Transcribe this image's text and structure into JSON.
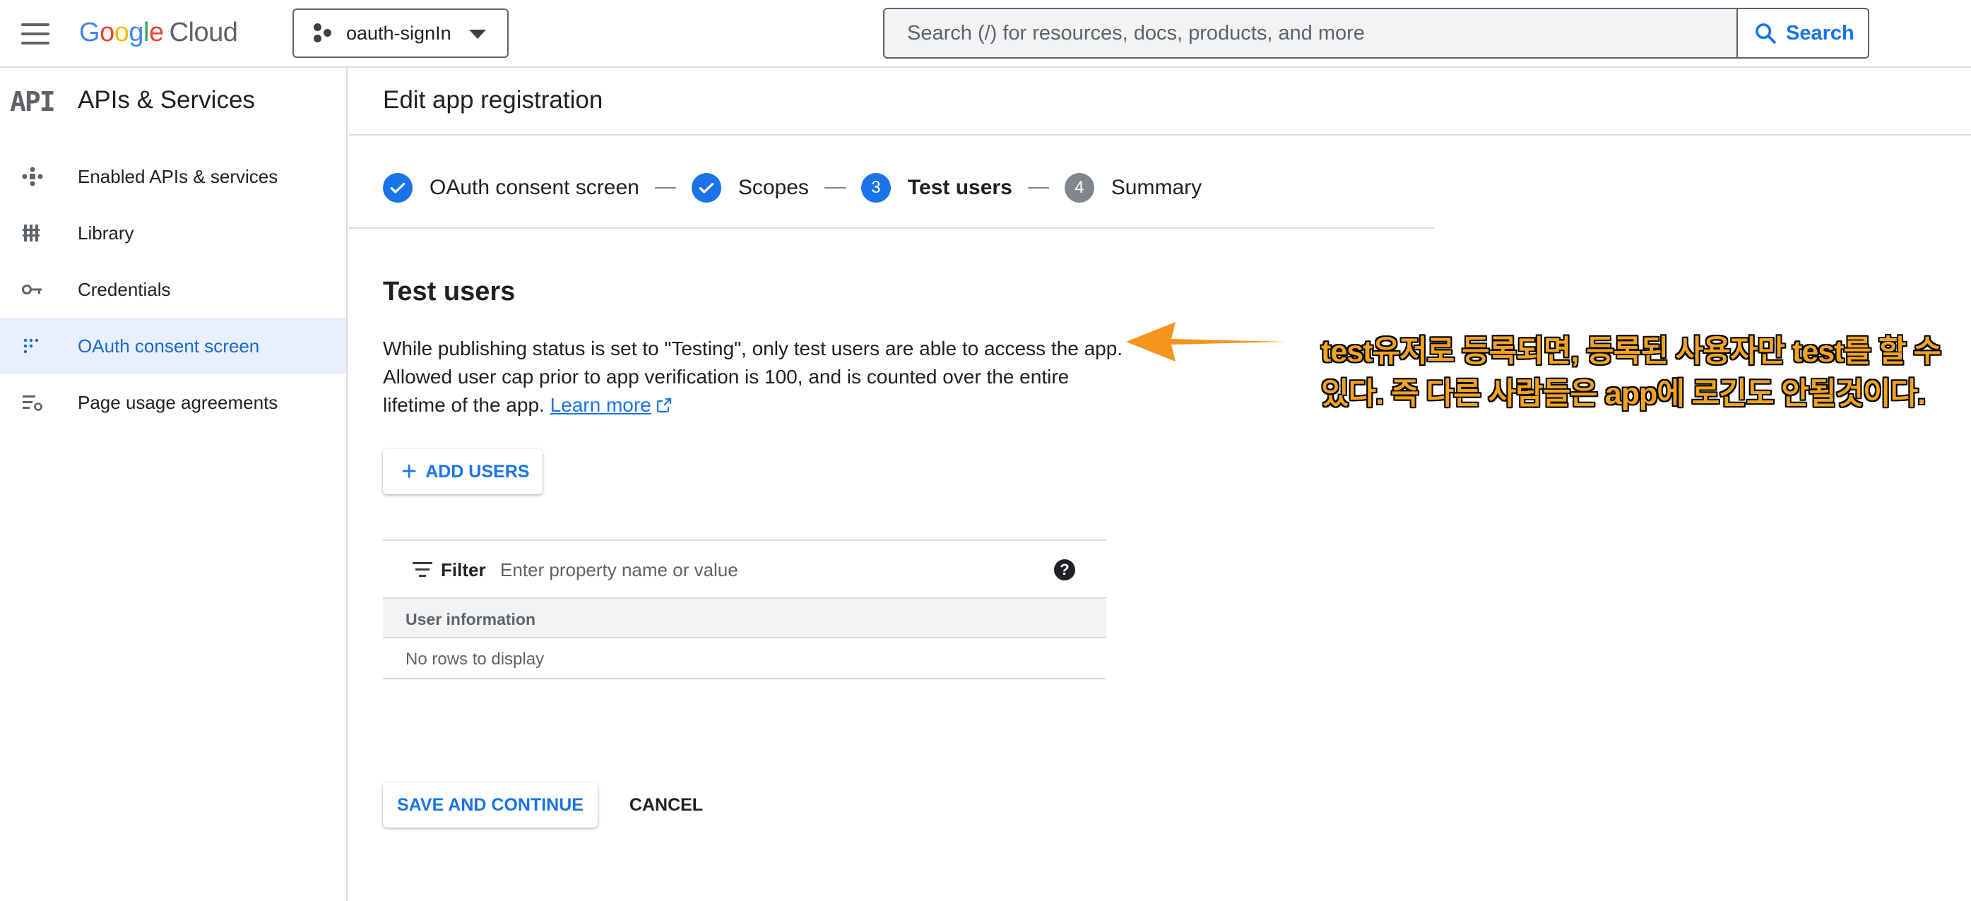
{
  "topbar": {
    "logo": {
      "g1": "G",
      "g2": "o",
      "g3": "o",
      "g4": "g",
      "g5": "l",
      "g6": "e",
      "cloud": "Cloud"
    },
    "project_name": "oauth-signIn",
    "search_placeholder": "Search (/) for resources, docs, products, and more",
    "search_label": "Search"
  },
  "sidebar": {
    "badge": "API",
    "title": "APIs & Services",
    "items": [
      {
        "label": "Enabled APIs & services",
        "icon": "enabled-apis-icon",
        "active": false
      },
      {
        "label": "Library",
        "icon": "library-icon",
        "active": false
      },
      {
        "label": "Credentials",
        "icon": "key-icon",
        "active": false
      },
      {
        "label": "OAuth consent screen",
        "icon": "consent-icon",
        "active": true
      },
      {
        "label": "Page usage agreements",
        "icon": "settings-list-icon",
        "active": false
      }
    ]
  },
  "main": {
    "page_title": "Edit app registration",
    "steps": [
      {
        "label": "OAuth consent screen",
        "state": "done"
      },
      {
        "label": "Scopes",
        "state": "done"
      },
      {
        "number": "3",
        "label": "Test users",
        "state": "current"
      },
      {
        "number": "4",
        "label": "Summary",
        "state": "todo"
      }
    ],
    "section_title": "Test users",
    "description": "While publishing status is set to \"Testing\", only test users are able to access the app. Allowed user cap prior to app verification is 100, and is counted over the entire lifetime of the app.",
    "learn_more": "Learn more",
    "add_users_label": "ADD USERS",
    "filter": {
      "label": "Filter",
      "placeholder": "Enter property name or value",
      "help": "?"
    },
    "table": {
      "column_header": "User information",
      "empty_text": "No rows to display"
    },
    "save_label": "SAVE AND CONTINUE",
    "cancel_label": "CANCEL"
  },
  "annotation": {
    "text": "test유저로 등록되면, 등록된 사용자만 test를 할 수 있다. 즉 다른 사람들은 app에 로긴도 안될것이다.",
    "color": "#f4a31f"
  },
  "colors": {
    "accent": "#1a73e8",
    "active_bg": "#e8f0fe",
    "border": "#dadce0"
  }
}
